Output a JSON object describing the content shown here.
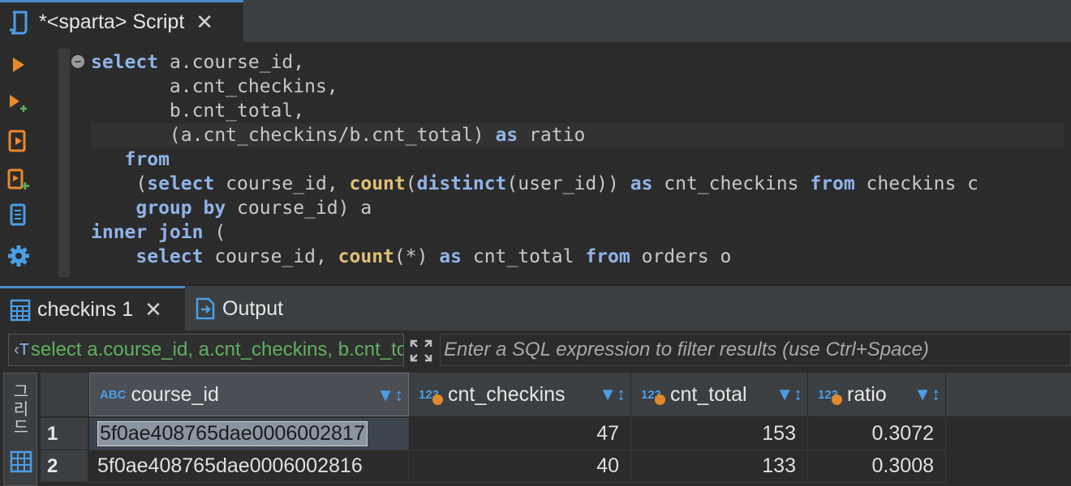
{
  "editor_tab": {
    "title": "*<sparta> Script",
    "close": "✕"
  },
  "toolbar": [
    "execute-statement-icon",
    "execute-in-new-tab-icon",
    "execute-script-icon",
    "execute-script-new-tab-icon",
    "explain-plan-icon",
    "settings-gear-icon"
  ],
  "sql_lines": [
    [
      {
        "t": "select",
        "k": "kw"
      },
      {
        "t": " a.course_id,",
        "k": ""
      }
    ],
    [
      {
        "t": "       a.cnt_checkins,",
        "k": ""
      }
    ],
    [
      {
        "t": "       b.cnt_total,",
        "k": ""
      }
    ],
    [
      {
        "t": "       (a.cnt_checkins/b.cnt_total) ",
        "k": ""
      },
      {
        "t": "as",
        "k": "kw"
      },
      {
        "t": " ratio",
        "k": ""
      }
    ],
    [
      {
        "t": "   ",
        "k": ""
      },
      {
        "t": "from",
        "k": "kw"
      }
    ],
    [
      {
        "t": "    (",
        "k": ""
      },
      {
        "t": "select",
        "k": "kw"
      },
      {
        "t": " course_id, ",
        "k": ""
      },
      {
        "t": "count",
        "k": "fn"
      },
      {
        "t": "(",
        "k": ""
      },
      {
        "t": "distinct",
        "k": "kw"
      },
      {
        "t": "(user_id)) ",
        "k": ""
      },
      {
        "t": "as",
        "k": "kw"
      },
      {
        "t": " cnt_checkins ",
        "k": ""
      },
      {
        "t": "from",
        "k": "kw"
      },
      {
        "t": " checkins c",
        "k": ""
      }
    ],
    [
      {
        "t": "    ",
        "k": ""
      },
      {
        "t": "group by",
        "k": "kw"
      },
      {
        "t": " course_id) a",
        "k": ""
      }
    ],
    [
      {
        "t": "inner join",
        "k": "kw"
      },
      {
        "t": " (",
        "k": ""
      }
    ],
    [
      {
        "t": "    ",
        "k": ""
      },
      {
        "t": "select",
        "k": "kw"
      },
      {
        "t": " course_id, ",
        "k": ""
      },
      {
        "t": "count",
        "k": "fn"
      },
      {
        "t": "(*) ",
        "k": ""
      },
      {
        "t": "as",
        "k": "kw"
      },
      {
        "t": " cnt_total ",
        "k": ""
      },
      {
        "t": "from",
        "k": "kw"
      },
      {
        "t": " orders o",
        "k": ""
      }
    ]
  ],
  "results_tabs": {
    "active": "checkins 1",
    "close": "✕",
    "output": "Output"
  },
  "filter": {
    "query_icon": "‹T",
    "query_text": "select a.course_id, a.cnt_checkins, b.cnt_total",
    "placeholder": "Enter a SQL expression to filter results (use Ctrl+Space)"
  },
  "view_panel_label": "그리드",
  "grid": {
    "columns": [
      {
        "name": "course_id",
        "type": "ABC"
      },
      {
        "name": "cnt_checkins",
        "type": "123"
      },
      {
        "name": "cnt_total",
        "type": "123"
      },
      {
        "name": "ratio",
        "type": "123"
      }
    ],
    "rows": [
      {
        "n": "1",
        "course_id": "5f0ae408765dae0006002817",
        "cnt_checkins": "47",
        "cnt_total": "153",
        "ratio": "0.3072"
      },
      {
        "n": "2",
        "course_id": "5f0ae408765dae0006002816",
        "cnt_checkins": "40",
        "cnt_total": "133",
        "ratio": "0.3008"
      }
    ]
  },
  "colors": {
    "accent": "#4a88c7",
    "keyword": "#8fb4e8",
    "function": "#e0c074",
    "query_text": "#5fb05f"
  }
}
